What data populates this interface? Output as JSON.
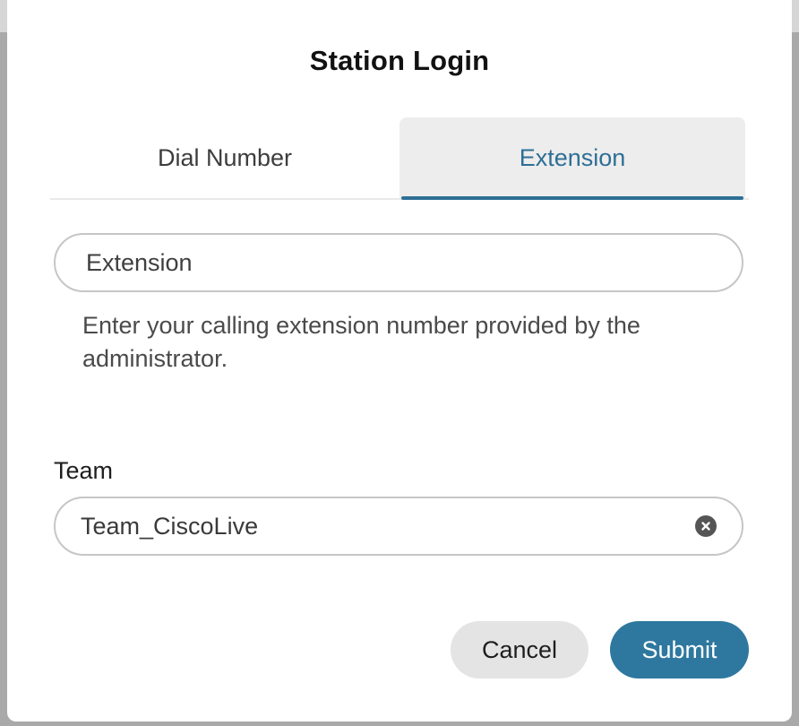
{
  "dialog": {
    "title": "Station Login"
  },
  "tabs": [
    {
      "label": "Dial Number",
      "selected": false
    },
    {
      "label": "Extension",
      "selected": true
    }
  ],
  "extension": {
    "placeholder": "Extension",
    "value": "",
    "help": "Enter your calling extension number provided by the administrator."
  },
  "team": {
    "label": "Team",
    "value": "Team_CiscoLive",
    "clear_icon": "clear-circle-x-icon"
  },
  "actions": {
    "cancel_label": "Cancel",
    "submit_label": "Submit"
  },
  "colors": {
    "accent": "#2e789f",
    "tab_accent": "#2e6f96",
    "selected_tab_bg": "#ededed",
    "cancel_bg": "#e4e4e4"
  }
}
